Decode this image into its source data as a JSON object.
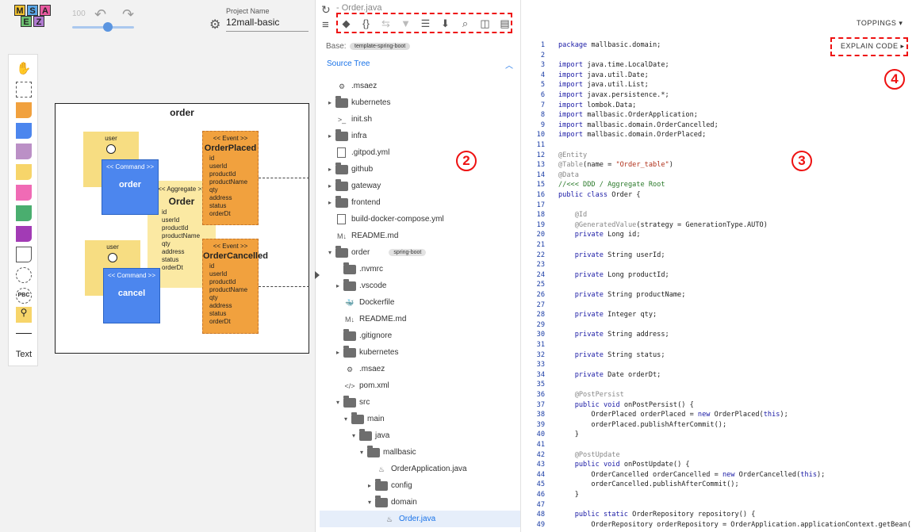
{
  "app": {
    "logo_letters": [
      "M",
      "S",
      "A",
      "E",
      "Z"
    ],
    "zoom": "100",
    "project_label": "Project Name",
    "project_name": "12mall-basic"
  },
  "palette": {
    "text_label": "Text"
  },
  "canvas": {
    "title": "order",
    "actors": [
      {
        "label": "user"
      },
      {
        "label": "user"
      }
    ],
    "commands": [
      {
        "head": "<< Command >>",
        "name": "order"
      },
      {
        "head": "<< Command >>",
        "name": "cancel"
      }
    ],
    "aggregate": {
      "head": "<< Aggregate >>",
      "name": "Order",
      "fields": [
        "id",
        "userId",
        "productId",
        "productName",
        "qty",
        "address",
        "status",
        "orderDt"
      ]
    },
    "events": [
      {
        "head": "<< Event >>",
        "name": "OrderPlaced",
        "fields": [
          "id",
          "userId",
          "productId",
          "productName",
          "qty",
          "address",
          "status",
          "orderDt"
        ]
      },
      {
        "head": "<< Event >>",
        "name": "OrderCancelled",
        "fields": [
          "id",
          "userId",
          "productId",
          "productName",
          "qty",
          "address",
          "status",
          "orderDt"
        ]
      }
    ]
  },
  "editor": {
    "file_title": "- Order.java",
    "base_label": "Base:",
    "base_value": "template-spring-boot",
    "source_tree_label": "Source Tree",
    "toppings_label": "TOPPINGS",
    "explain_label": "EXPLAIN CODE",
    "annotations": [
      "1",
      "2",
      "3",
      "4"
    ]
  },
  "tree": [
    {
      "name": ".msaez",
      "icon": "gear",
      "arrow": "",
      "indent": 0
    },
    {
      "name": "kubernetes",
      "icon": "folder",
      "arrow": "›",
      "indent": 0
    },
    {
      "name": "init.sh",
      "icon": "terminal",
      "arrow": "",
      "indent": 0
    },
    {
      "name": "infra",
      "icon": "folder",
      "arrow": "›",
      "indent": 0
    },
    {
      "name": ".gitpod.yml",
      "icon": "file",
      "arrow": "",
      "indent": 0
    },
    {
      "name": "github",
      "icon": "folder",
      "arrow": "›",
      "indent": 0
    },
    {
      "name": "gateway",
      "icon": "folder",
      "arrow": "›",
      "indent": 0
    },
    {
      "name": "frontend",
      "icon": "folder",
      "arrow": "›",
      "indent": 0
    },
    {
      "name": "build-docker-compose.yml",
      "icon": "file",
      "arrow": "",
      "indent": 0
    },
    {
      "name": "README.md",
      "icon": "md",
      "arrow": "",
      "indent": 0
    },
    {
      "name": "order",
      "icon": "folder",
      "arrow": "⌄",
      "indent": 0,
      "badge": "spring-boot"
    },
    {
      "name": ".nvmrc",
      "icon": "folder",
      "arrow": "",
      "indent": 1
    },
    {
      "name": ".vscode",
      "icon": "folder",
      "arrow": "›",
      "indent": 1
    },
    {
      "name": "Dockerfile",
      "icon": "docker",
      "arrow": "",
      "indent": 1
    },
    {
      "name": "README.md",
      "icon": "md",
      "arrow": "",
      "indent": 1
    },
    {
      "name": ".gitignore",
      "icon": "folder",
      "arrow": "",
      "indent": 1
    },
    {
      "name": "kubernetes",
      "icon": "folder",
      "arrow": "›",
      "indent": 1
    },
    {
      "name": ".msaez",
      "icon": "gear",
      "arrow": "",
      "indent": 1
    },
    {
      "name": "pom.xml",
      "icon": "code",
      "arrow": "",
      "indent": 1
    },
    {
      "name": "src",
      "icon": "folder",
      "arrow": "⌄",
      "indent": 1
    },
    {
      "name": "main",
      "icon": "folder",
      "arrow": "⌄",
      "indent": 2
    },
    {
      "name": "java",
      "icon": "folder",
      "arrow": "⌄",
      "indent": 3
    },
    {
      "name": "mallbasic",
      "icon": "folder",
      "arrow": "⌄",
      "indent": 4
    },
    {
      "name": "OrderApplication.java",
      "icon": "java",
      "arrow": "",
      "indent": 5
    },
    {
      "name": "config",
      "icon": "folder",
      "arrow": "›",
      "indent": 5
    },
    {
      "name": "domain",
      "icon": "folder",
      "arrow": "⌄",
      "indent": 5
    },
    {
      "name": "Order.java",
      "icon": "java",
      "arrow": "",
      "indent": 6,
      "selected": true
    }
  ],
  "code": [
    {
      "n": "1",
      "t": "package mallbasic.domain;"
    },
    {
      "n": "2",
      "t": ""
    },
    {
      "n": "3",
      "t": "import java.time.LocalDate;"
    },
    {
      "n": "4",
      "t": "import java.util.Date;"
    },
    {
      "n": "5",
      "t": "import java.util.List;"
    },
    {
      "n": "6",
      "t": "import javax.persistence.*;"
    },
    {
      "n": "7",
      "t": "import lombok.Data;"
    },
    {
      "n": "8",
      "t": "import mallbasic.OrderApplication;"
    },
    {
      "n": "9",
      "t": "import mallbasic.domain.OrderCancelled;"
    },
    {
      "n": "10",
      "t": "import mallbasic.domain.OrderPlaced;"
    },
    {
      "n": "11",
      "t": ""
    },
    {
      "n": "12",
      "t": "@Entity"
    },
    {
      "n": "13",
      "t": "@Table(name = \"Order_table\")"
    },
    {
      "n": "14",
      "t": "@Data"
    },
    {
      "n": "15",
      "t": "//<<< DDD / Aggregate Root"
    },
    {
      "n": "16",
      "t": "public class Order {"
    },
    {
      "n": "17",
      "t": ""
    },
    {
      "n": "18",
      "t": "    @Id"
    },
    {
      "n": "19",
      "t": "    @GeneratedValue(strategy = GenerationType.AUTO)"
    },
    {
      "n": "20",
      "t": "    private Long id;"
    },
    {
      "n": "21",
      "t": ""
    },
    {
      "n": "22",
      "t": "    private String userId;"
    },
    {
      "n": "23",
      "t": ""
    },
    {
      "n": "24",
      "t": "    private Long productId;"
    },
    {
      "n": "25",
      "t": ""
    },
    {
      "n": "26",
      "t": "    private String productName;"
    },
    {
      "n": "27",
      "t": ""
    },
    {
      "n": "28",
      "t": "    private Integer qty;"
    },
    {
      "n": "29",
      "t": ""
    },
    {
      "n": "30",
      "t": "    private String address;"
    },
    {
      "n": "31",
      "t": ""
    },
    {
      "n": "32",
      "t": "    private String status;"
    },
    {
      "n": "33",
      "t": ""
    },
    {
      "n": "34",
      "t": "    private Date orderDt;"
    },
    {
      "n": "35",
      "t": ""
    },
    {
      "n": "36",
      "t": "    @PostPersist"
    },
    {
      "n": "37",
      "t": "    public void onPostPersist() {"
    },
    {
      "n": "38",
      "t": "        OrderPlaced orderPlaced = new OrderPlaced(this);"
    },
    {
      "n": "39",
      "t": "        orderPlaced.publishAfterCommit();"
    },
    {
      "n": "40",
      "t": "    }"
    },
    {
      "n": "41",
      "t": ""
    },
    {
      "n": "42",
      "t": "    @PostUpdate"
    },
    {
      "n": "43",
      "t": "    public void onPostUpdate() {"
    },
    {
      "n": "44",
      "t": "        OrderCancelled orderCancelled = new OrderCancelled(this);"
    },
    {
      "n": "45",
      "t": "        orderCancelled.publishAfterCommit();"
    },
    {
      "n": "46",
      "t": "    }"
    },
    {
      "n": "47",
      "t": ""
    },
    {
      "n": "48",
      "t": "    public static OrderRepository repository() {"
    },
    {
      "n": "49",
      "t": "        OrderRepository orderRepository = OrderApplication.applicationContext.getBean("
    }
  ]
}
